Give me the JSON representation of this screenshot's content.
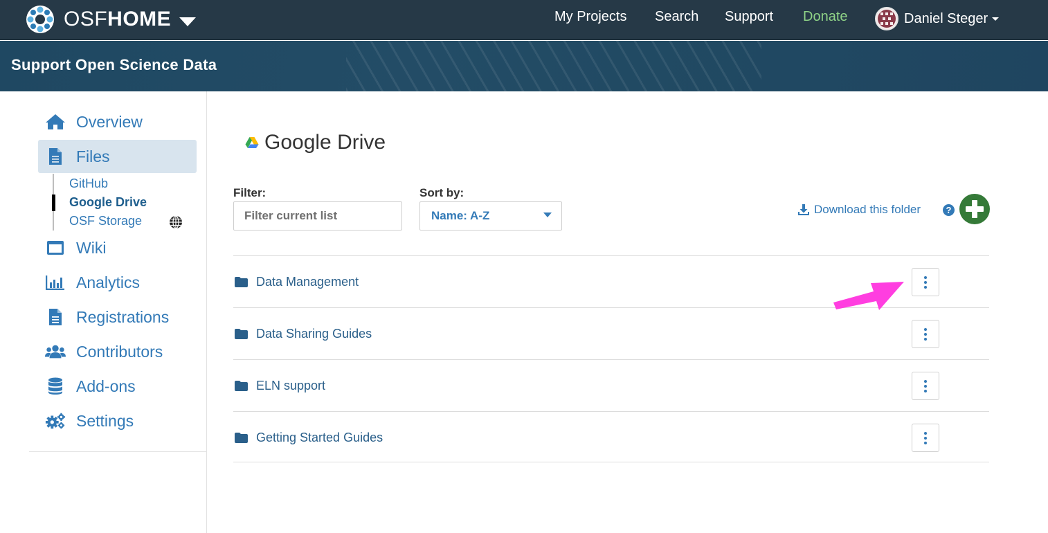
{
  "navbar": {
    "brand_osf": "OSF",
    "brand_home": "HOME",
    "links": [
      {
        "label": "My Projects"
      },
      {
        "label": "Search"
      },
      {
        "label": "Support"
      },
      {
        "label": "Donate"
      }
    ],
    "user_name": "Daniel Steger"
  },
  "banner": {
    "title": "Support Open Science Data"
  },
  "sidebar": {
    "items": [
      {
        "label": "Overview",
        "icon": "home-icon"
      },
      {
        "label": "Files",
        "icon": "file-icon",
        "active": true
      },
      {
        "label": "Wiki",
        "icon": "wiki-icon"
      },
      {
        "label": "Analytics",
        "icon": "bar-chart-icon"
      },
      {
        "label": "Registrations",
        "icon": "file-icon"
      },
      {
        "label": "Contributors",
        "icon": "users-icon"
      },
      {
        "label": "Add-ons",
        "icon": "database-icon"
      },
      {
        "label": "Settings",
        "icon": "gears-icon"
      }
    ],
    "storage": [
      {
        "label": "GitHub"
      },
      {
        "label": "Google Drive",
        "active": true
      },
      {
        "label": "OSF Storage"
      }
    ]
  },
  "main": {
    "title": "Google Drive",
    "filter_label": "Filter:",
    "filter_placeholder": "Filter current list",
    "sort_label": "Sort by:",
    "sort_value": "Name: A-Z",
    "download_label": "Download this folder",
    "help": "?",
    "folders": [
      {
        "name": "Data Management"
      },
      {
        "name": "Data Sharing Guides"
      },
      {
        "name": "ELN support"
      },
      {
        "name": "Getting Started Guides"
      }
    ]
  },
  "colors": {
    "navbar": "#263947",
    "banner": "#214a63",
    "link": "#337ab7",
    "donate": "#8fd387",
    "add_button": "#357a38",
    "annotation_arrow": "#ff3ee0"
  }
}
